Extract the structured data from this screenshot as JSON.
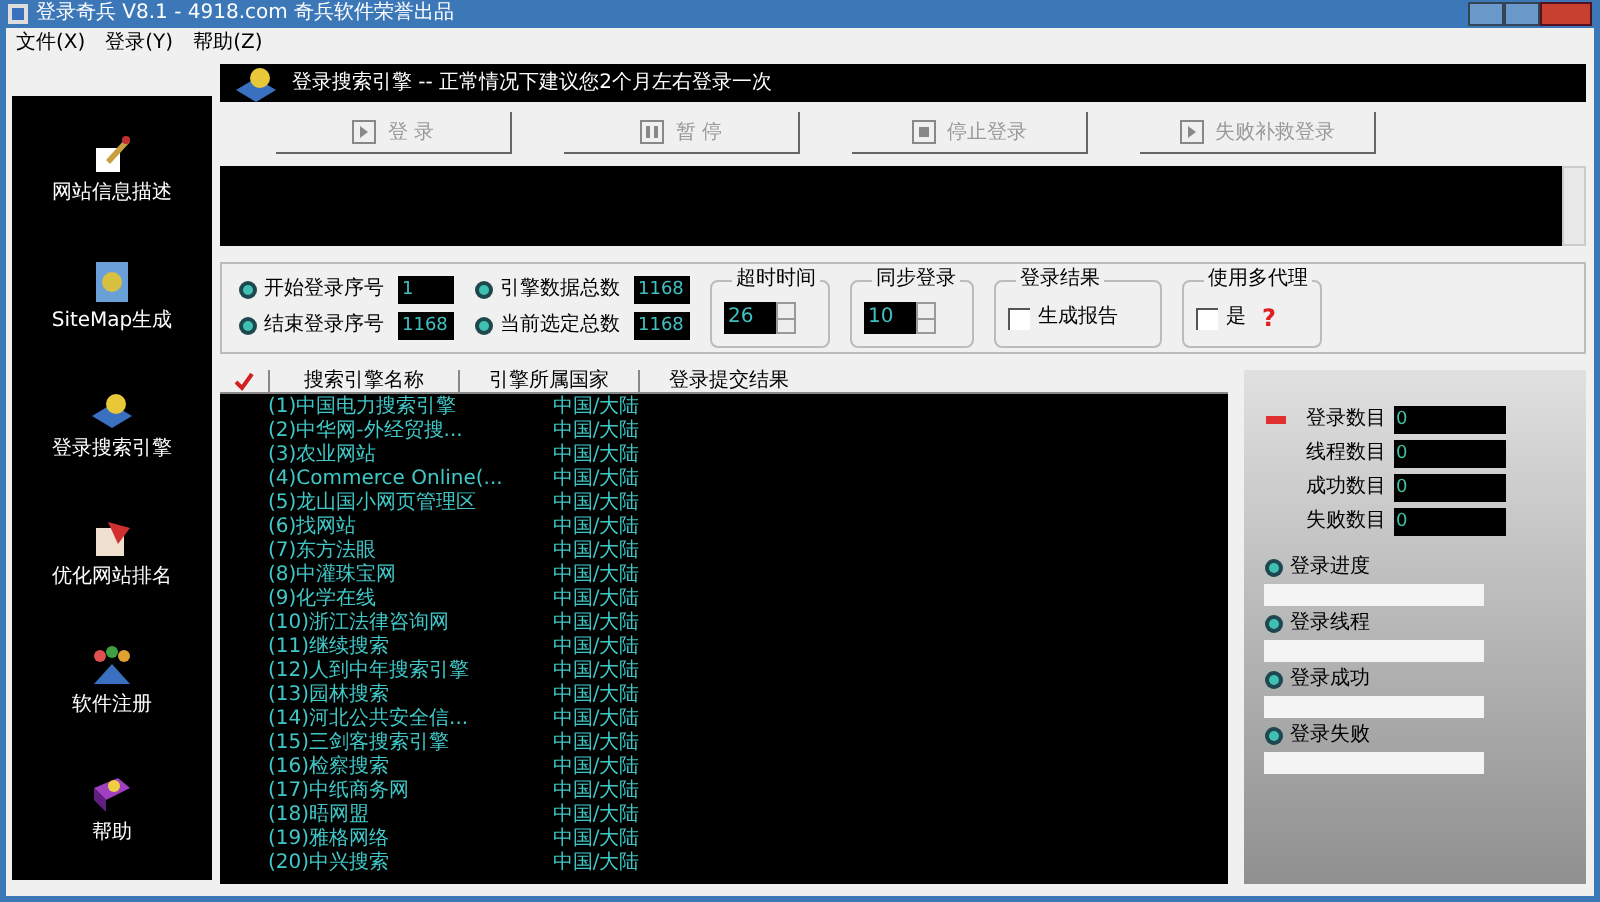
{
  "window": {
    "title": "登录奇兵 V8.1 - 4918.com 奇兵软件荣誉出品"
  },
  "menu": [
    "文件(X)",
    "登录(Y)",
    "帮助(Z)"
  ],
  "sidebar": [
    {
      "label": "网站信息描述",
      "kind": "pen"
    },
    {
      "label": "SiteMap生成",
      "kind": "map"
    },
    {
      "label": "登录搜索引擎",
      "kind": "book"
    },
    {
      "label": "优化网站排名",
      "kind": "flag"
    },
    {
      "label": "软件注册",
      "kind": "people"
    },
    {
      "label": "帮助",
      "kind": "help"
    }
  ],
  "header": "登录搜索引擎 -- 正常情况下建议您2个月左右登录一次",
  "buttons": [
    {
      "label": "登 录",
      "kind": "play",
      "disabled": true
    },
    {
      "label": "暂 停",
      "kind": "pause",
      "disabled": true
    },
    {
      "label": "停止登录",
      "kind": "stop",
      "disabled": true
    },
    {
      "label": "失败补救登录",
      "kind": "play",
      "disabled": true
    }
  ],
  "options": {
    "fields": [
      {
        "label": "开始登录序号",
        "value": "1"
      },
      {
        "label": "结束登录序号",
        "value": "1168"
      },
      {
        "label": "引擎数据总数",
        "value": "1168"
      },
      {
        "label": "当前选定总数",
        "value": "1168"
      }
    ],
    "timeout": {
      "title": "超时时间",
      "value": "26"
    },
    "sync": {
      "title": "同步登录",
      "value": "10"
    },
    "result": {
      "title": "登录结果",
      "label": "生成报告",
      "checked": false
    },
    "proxy": {
      "title": "使用多代理",
      "label": "是",
      "checked": false,
      "help": "?"
    }
  },
  "table": {
    "columns": [
      "搜索引擎名称",
      "引擎所属国家",
      "登录提交结果"
    ],
    "rows": [
      [
        "(1)中国电力搜索引擎",
        "中国/大陆"
      ],
      [
        "(2)中华网-外经贸搜...",
        "中国/大陆"
      ],
      [
        "(3)农业网站",
        "中国/大陆"
      ],
      [
        "(4)Commerce Online(...",
        "中国/大陆"
      ],
      [
        "(5)龙山国小网页管理区",
        "中国/大陆"
      ],
      [
        "(6)找网站",
        "中国/大陆"
      ],
      [
        "(7)东方法眼",
        "中国/大陆"
      ],
      [
        "(8)中灌珠宝网",
        "中国/大陆"
      ],
      [
        "(9)化学在线",
        "中国/大陆"
      ],
      [
        "(10)浙江法律咨询网",
        "中国/大陆"
      ],
      [
        "(11)继续搜索",
        "中国/大陆"
      ],
      [
        "(12)人到中年搜索引擎",
        "中国/大陆"
      ],
      [
        "(13)园林搜索",
        "中国/大陆"
      ],
      [
        "(14)河北公共安全信...",
        "中国/大陆"
      ],
      [
        "(15)三剑客搜索引擎",
        "中国/大陆"
      ],
      [
        "(16)检察搜索",
        "中国/大陆"
      ],
      [
        "(17)中纸商务网",
        "中国/大陆"
      ],
      [
        "(18)晤网盟",
        "中国/大陆"
      ],
      [
        "(19)雅格网络",
        "中国/大陆"
      ],
      [
        "(20)中兴搜索",
        "中国/大陆"
      ]
    ]
  },
  "stats": {
    "counters": [
      {
        "label": "登录数目",
        "value": "0"
      },
      {
        "label": "线程数目",
        "value": "0"
      },
      {
        "label": "成功数目",
        "value": "0"
      },
      {
        "label": "失败数目",
        "value": "0"
      }
    ],
    "bars": [
      {
        "label": "登录进度"
      },
      {
        "label": "登录线程"
      },
      {
        "label": "登录成功"
      },
      {
        "label": "登录失败"
      }
    ]
  }
}
